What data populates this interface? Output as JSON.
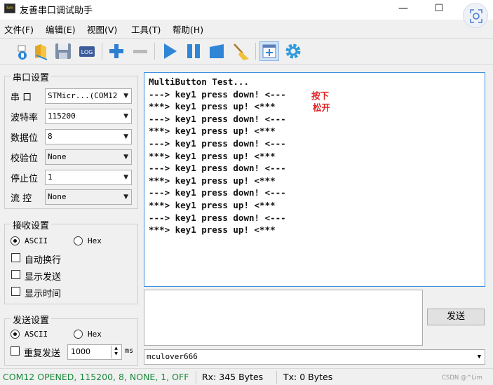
{
  "window": {
    "title": "友善串口调试助手",
    "app_icon_text": "Sm",
    "minimize_glyph": "—",
    "maximize_glyph": "☐"
  },
  "menu": {
    "items": [
      {
        "label": "文件(F)"
      },
      {
        "label": "编辑(E)"
      },
      {
        "label": "视图(V)"
      },
      {
        "label": "工具(T)"
      },
      {
        "label": "帮助(H)"
      }
    ]
  },
  "toolbar": {
    "icons": [
      "new-icon",
      "open-icon",
      "save-icon",
      "log-icon",
      "add-icon",
      "remove-icon",
      "play-icon",
      "pause-icon",
      "stop-icon",
      "clear-broom-icon",
      "window-icon",
      "settings-gear-icon"
    ],
    "log_text": "LOG",
    "colors": {
      "blue": "#2f86d6",
      "green_plus": "#2e7fd0"
    }
  },
  "serial_settings": {
    "title": "串口设置",
    "port_label": "串 口",
    "port_value": "STMicr...(COM12",
    "baud_label": "波特率",
    "baud_value": "115200",
    "databits_label": "数据位",
    "databits_value": "8",
    "parity_label": "校验位",
    "parity_value": "None",
    "stopbits_label": "停止位",
    "stopbits_value": "1",
    "flow_label": "流 控",
    "flow_value": "None"
  },
  "receive_settings": {
    "title": "接收设置",
    "ascii_label": "ASCII",
    "hex_label": "Hex",
    "selected": "ASCII",
    "auto_wrap_label": "自动换行",
    "show_send_label": "显示发送",
    "show_time_label": "显示时间"
  },
  "send_settings": {
    "title": "发送设置",
    "ascii_label": "ASCII",
    "hex_label": "Hex",
    "selected": "ASCII",
    "repeat_label": "重复发送",
    "interval_value": "1000",
    "interval_unit": "ms"
  },
  "receive_area": {
    "lines": [
      "MultiButton Test...",
      "---> key1 press down! <---",
      "***> key1 press up! <***",
      "---> key1 press down! <---",
      "***> key1 press up! <***",
      "---> key1 press down! <---",
      "***> key1 press up! <***",
      "---> key1 press down! <---",
      "***> key1 press up! <***",
      "---> key1 press down! <---",
      "***> key1 press up! <***",
      "---> key1 press down! <---",
      "***> key1 press up! <***"
    ],
    "annotation_down": "按下",
    "annotation_up": "松开",
    "annotation_color": "#e02020",
    "border_color": "#3c8fe0"
  },
  "send_area": {
    "text": "",
    "send_button_label": "发送",
    "history_value": "mculover666"
  },
  "status_bar": {
    "connection": "COM12 OPENED, 115200, 8, NONE, 1, OFF",
    "connection_color": "#1a8a3a",
    "rx": "Rx: 345 Bytes",
    "tx": "Tx: 0 Bytes",
    "watermark": "CSDN @^Lim"
  }
}
